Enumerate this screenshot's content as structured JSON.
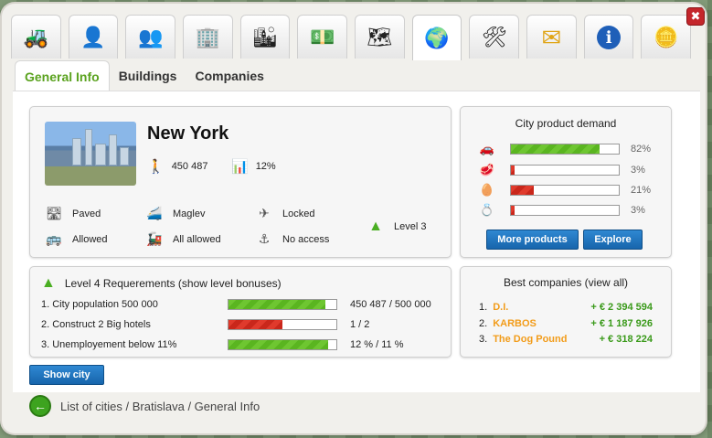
{
  "toolbar": {
    "items": [
      {
        "icon": "bulldozer-icon",
        "glyph": "🚜"
      },
      {
        "icon": "manager-icon",
        "glyph": "👤"
      },
      {
        "icon": "people-icon",
        "glyph": "👥"
      },
      {
        "icon": "building-icon",
        "glyph": "🏢"
      },
      {
        "icon": "city-icon",
        "glyph": "🏙"
      },
      {
        "icon": "money-icon",
        "glyph": "💵"
      },
      {
        "icon": "map-icon",
        "glyph": "🗺"
      },
      {
        "icon": "globe-icon",
        "glyph": "🌍",
        "active": true
      },
      {
        "icon": "tools-icon",
        "glyph": "🛠"
      },
      {
        "icon": "mail-icon",
        "glyph": "✉"
      },
      {
        "icon": "info-icon",
        "glyph": "ℹ"
      },
      {
        "icon": "coin-icon",
        "glyph": "🪙"
      }
    ],
    "close_label": "✖"
  },
  "subtabs": {
    "general": "General Info",
    "buildings": "Buildings",
    "companies": "Companies"
  },
  "city": {
    "name": "New York",
    "population": "450 487",
    "unemployment": "12%",
    "features": {
      "road": "Paved",
      "maglev": "Maglev",
      "airport": "Locked",
      "bus": "Allowed",
      "train": "All allowed",
      "port": "No access"
    },
    "level": "Level 3"
  },
  "demand": {
    "title": "City product demand",
    "items": [
      {
        "icon": "car-icon",
        "glyph": "🚗",
        "value": 0.82,
        "color": "green",
        "pct": "82%"
      },
      {
        "icon": "meat-icon",
        "glyph": "🥩",
        "value": 0.03,
        "color": "red",
        "pct": "3%"
      },
      {
        "icon": "egg-icon",
        "glyph": "🥚",
        "value": 0.21,
        "color": "red",
        "pct": "21%"
      },
      {
        "icon": "ring-icon",
        "glyph": "💍",
        "value": 0.03,
        "color": "red",
        "pct": "3%"
      }
    ],
    "more_label": "More products",
    "explore_label": "Explore"
  },
  "requirements": {
    "title": "Level 4 Requerements (show level bonuses)",
    "items": [
      {
        "label": "1. City population 500 000",
        "value": 0.9,
        "color": "green",
        "text": "450 487 / 500 000"
      },
      {
        "label": "2. Construct 2 Big hotels",
        "value": 0.5,
        "color": "red",
        "text": "1 / 2"
      },
      {
        "label": "3. Unemployement below 11%",
        "value": 0.92,
        "color": "green",
        "text": "12 % / 11 %"
      }
    ]
  },
  "companies": {
    "title": "Best companies (view all)",
    "items": [
      {
        "rank": "1.",
        "name": "D.I.",
        "value": "+ € 2 394 594"
      },
      {
        "rank": "2.",
        "name": "KARBOS",
        "value": "+ € 1 187 926"
      },
      {
        "rank": "3.",
        "name": "The Dog Pound",
        "value": "+ € 318 224"
      }
    ]
  },
  "show_city_label": "Show city",
  "breadcrumb": "List of cities / Bratislava / General Info"
}
